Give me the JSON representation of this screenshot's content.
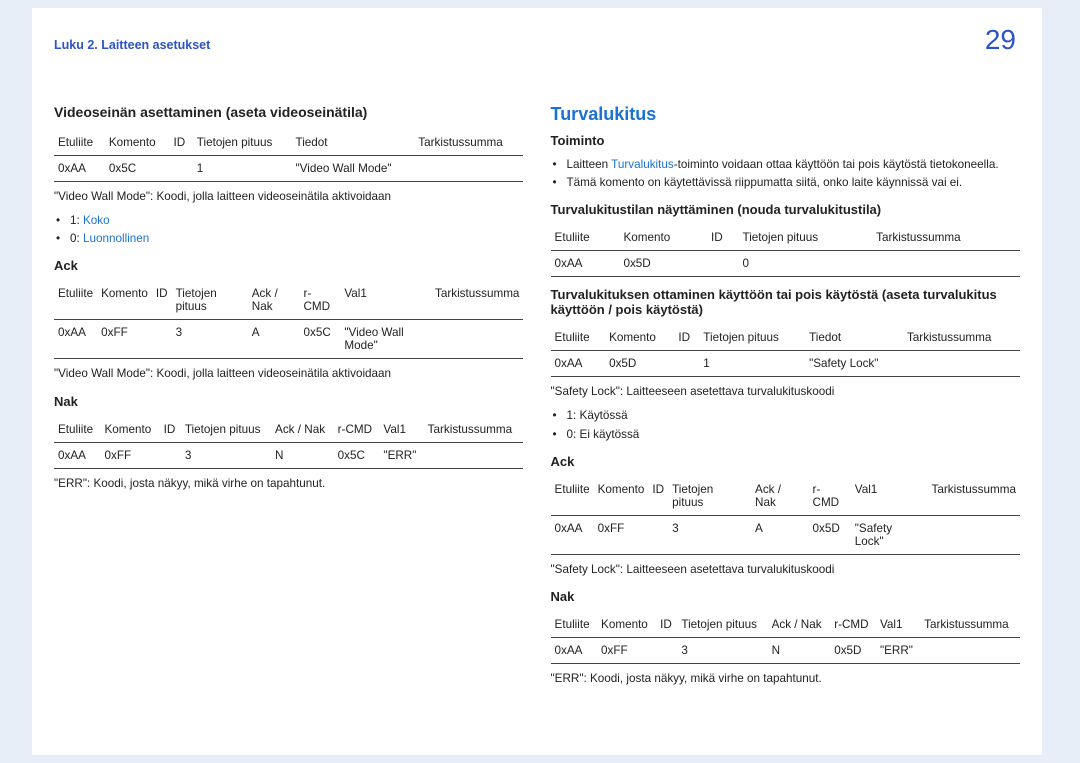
{
  "page": {
    "chapter": "Luku 2. Laitteen asetukset",
    "number": "29"
  },
  "left": {
    "h2": "Videoseinän asettaminen (aseta videoseinätila)",
    "table1": {
      "headers": [
        "Etuliite",
        "Komento",
        "ID",
        "Tietojen pituus",
        "Tiedot",
        "Tarkistussumma"
      ],
      "rows": [
        [
          "0xAA",
          "0x5C",
          "",
          "1",
          "\"Video Wall Mode\"",
          ""
        ]
      ]
    },
    "afterTable1": "\"Video Wall Mode\": Koodi, jolla laitteen videoseinätila aktivoidaan",
    "codes": [
      {
        "prefix": "1: ",
        "value": "Koko"
      },
      {
        "prefix": "0: ",
        "value": "Luonnollinen"
      }
    ],
    "ackTitle": "Ack",
    "tableAck": {
      "headers": [
        "Etuliite",
        "Komento",
        "ID",
        "Tietojen pituus",
        "Ack / Nak",
        "r-CMD",
        "Val1",
        "Tarkistussumma"
      ],
      "rows": [
        [
          "0xAA",
          "0xFF",
          "",
          "3",
          "A",
          "0x5C",
          "\"Video Wall Mode\"",
          ""
        ]
      ]
    },
    "afterAck": "\"Video Wall Mode\": Koodi, jolla laitteen videoseinätila aktivoidaan",
    "nakTitle": "Nak",
    "tableNak": {
      "headers": [
        "Etuliite",
        "Komento",
        "ID",
        "Tietojen pituus",
        "Ack / Nak",
        "r-CMD",
        "Val1",
        "Tarkistussumma"
      ],
      "rows": [
        [
          "0xAA",
          "0xFF",
          "",
          "3",
          "N",
          "0x5C",
          "\"ERR\"",
          ""
        ]
      ]
    },
    "afterNak": "\"ERR\": Koodi, josta näkyy, mikä virhe on tapahtunut."
  },
  "right": {
    "sectionTitle": "Turvalukitus",
    "functionTitle": "Toiminto",
    "functionBullets": [
      {
        "pre": "Laitteen ",
        "link": "Turvalukitus",
        "post": "-toiminto voidaan ottaa käyttöön tai pois käytöstä tietokoneella."
      },
      {
        "pre": "Tämä komento on käytettävissä riippumatta siitä, onko laite käynnissä vai ei.",
        "link": "",
        "post": ""
      }
    ],
    "viewTitle": "Turvalukitustilan näyttäminen (nouda turvalukitustila)",
    "tableView": {
      "headers": [
        "Etuliite",
        "Komento",
        "ID",
        "Tietojen pituus",
        "Tarkistussumma"
      ],
      "rows": [
        [
          "0xAA",
          "0x5D",
          "",
          "0",
          ""
        ]
      ]
    },
    "setTitle": "Turvalukituksen ottaminen käyttöön tai pois käytöstä (aseta turvalukitus käyttöön / pois käytöstä)",
    "tableSet": {
      "headers": [
        "Etuliite",
        "Komento",
        "ID",
        "Tietojen pituus",
        "Tiedot",
        "Tarkistussumma"
      ],
      "rows": [
        [
          "0xAA",
          "0x5D",
          "",
          "1",
          "\"Safety Lock\"",
          ""
        ]
      ]
    },
    "afterSet": "\"Safety Lock\": Laitteeseen asetettava turvalukituskoodi",
    "setCodes": [
      "1: Käytössä",
      "0: Ei käytössä"
    ],
    "ackTitle": "Ack",
    "tableAck": {
      "headers": [
        "Etuliite",
        "Komento",
        "ID",
        "Tietojen pituus",
        "Ack / Nak",
        "r-CMD",
        "Val1",
        "Tarkistussumma"
      ],
      "rows": [
        [
          "0xAA",
          "0xFF",
          "",
          "3",
          "A",
          "0x5D",
          "\"Safety Lock\"",
          ""
        ]
      ]
    },
    "afterAck": "\"Safety Lock\": Laitteeseen asetettava turvalukituskoodi",
    "nakTitle": "Nak",
    "tableNak": {
      "headers": [
        "Etuliite",
        "Komento",
        "ID",
        "Tietojen pituus",
        "Ack / Nak",
        "r-CMD",
        "Val1",
        "Tarkistussumma"
      ],
      "rows": [
        [
          "0xAA",
          "0xFF",
          "",
          "3",
          "N",
          "0x5D",
          "\"ERR\"",
          ""
        ]
      ]
    },
    "afterNak": "\"ERR\": Koodi, josta näkyy, mikä virhe on tapahtunut."
  }
}
